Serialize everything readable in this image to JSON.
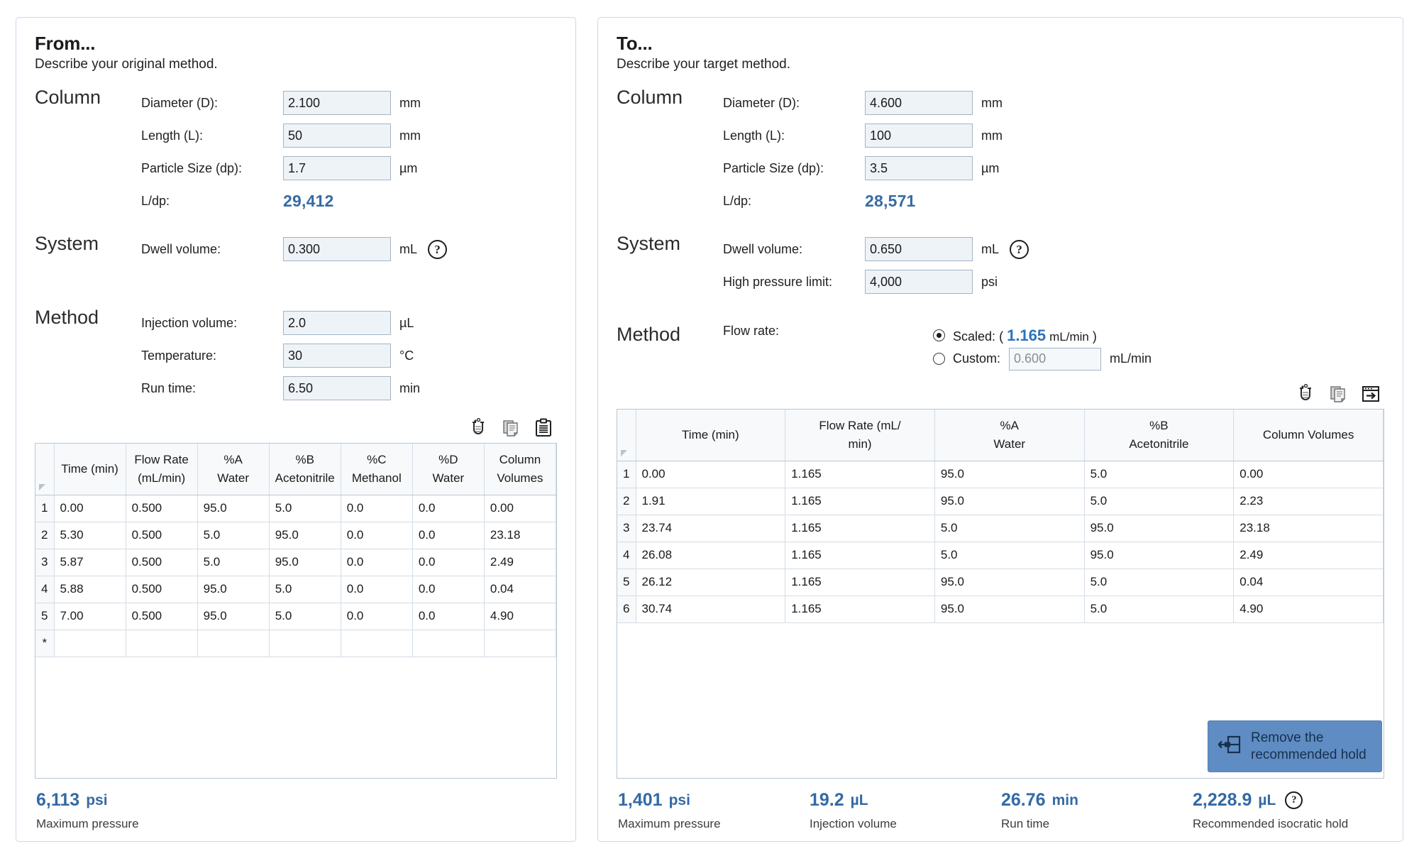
{
  "accent_blue": "#336aa3",
  "panels": [
    {
      "id": "from",
      "title": "From...",
      "subtitle": "Describe your original method.",
      "sections": {
        "column": {
          "label": "Column",
          "fields": [
            {
              "label": "Diameter (D):",
              "value": "2.100",
              "unit": "mm"
            },
            {
              "label": "Length (L):",
              "value": "50",
              "unit": "mm"
            },
            {
              "label": "Particle Size (dp):",
              "value": "1.7",
              "unit": "µm"
            }
          ],
          "calc_label": "L/dp:",
          "calc_value": "29,412"
        },
        "system": {
          "label": "System",
          "fields": [
            {
              "label": "Dwell volume:",
              "value": "0.300",
              "unit": "mL",
              "help": "?"
            }
          ]
        },
        "method": {
          "label": "Method",
          "fields": [
            {
              "label": "Injection volume:",
              "value": "2.0",
              "unit": "µL"
            },
            {
              "label": "Temperature:",
              "value": "30",
              "unit": "°C"
            },
            {
              "label": "Run time:",
              "value": "6.50",
              "unit": "min"
            }
          ]
        }
      },
      "toolbar": [
        {
          "name": "extract-gradient-icon",
          "title": "Extract"
        },
        {
          "name": "copy-icon",
          "title": "Copy"
        },
        {
          "name": "paste-clipboard-icon",
          "title": "Paste"
        }
      ],
      "table": {
        "columns": [
          {
            "line1": "Time (min)",
            "line2": ""
          },
          {
            "line1": "Flow Rate",
            "line2": "(mL/min)"
          },
          {
            "line1": "%A",
            "line2": "Water"
          },
          {
            "line1": "%B",
            "line2": "Acetonitrile"
          },
          {
            "line1": "%C",
            "line2": "Methanol"
          },
          {
            "line1": "%D",
            "line2": "Water"
          },
          {
            "line1": "Column",
            "line2": "Volumes"
          }
        ],
        "rows": [
          {
            "n": "1",
            "cells": [
              "0.00",
              "0.500",
              "95.0",
              "5.0",
              "0.0",
              "0.0",
              "0.00"
            ]
          },
          {
            "n": "2",
            "cells": [
              "5.30",
              "0.500",
              "5.0",
              "95.0",
              "0.0",
              "0.0",
              "23.18"
            ]
          },
          {
            "n": "3",
            "cells": [
              "5.87",
              "0.500",
              "5.0",
              "95.0",
              "0.0",
              "0.0",
              "2.49"
            ]
          },
          {
            "n": "4",
            "cells": [
              "5.88",
              "0.500",
              "95.0",
              "5.0",
              "0.0",
              "0.0",
              "0.04"
            ]
          },
          {
            "n": "5",
            "cells": [
              "7.00",
              "0.500",
              "95.0",
              "5.0",
              "0.0",
              "0.0",
              "4.90"
            ]
          },
          {
            "n": "*",
            "cells": [
              "",
              "",
              "",
              "",
              "",
              "",
              ""
            ]
          }
        ]
      },
      "summary": [
        {
          "value": "6,113",
          "unit": "psi",
          "label": "Maximum pressure",
          "help": ""
        }
      ]
    },
    {
      "id": "to",
      "title": "To...",
      "subtitle": "Describe your target method.",
      "sections": {
        "column": {
          "label": "Column",
          "fields": [
            {
              "label": "Diameter (D):",
              "value": "4.600",
              "unit": "mm"
            },
            {
              "label": "Length (L):",
              "value": "100",
              "unit": "mm"
            },
            {
              "label": "Particle Size (dp):",
              "value": "3.5",
              "unit": "µm"
            }
          ],
          "calc_label": "L/dp:",
          "calc_value": "28,571"
        },
        "system": {
          "label": "System",
          "fields": [
            {
              "label": "Dwell volume:",
              "value": "0.650",
              "unit": "mL",
              "help": "?"
            },
            {
              "label": "High pressure limit:",
              "value": "4,000",
              "unit": "psi"
            }
          ]
        },
        "method": {
          "label": "Method",
          "flow_label": "Flow rate:",
          "options": [
            {
              "id": "scaled",
              "selected": true,
              "label": "Scaled:",
              "open": "(",
              "value": "1.165",
              "unit": "mL/min",
              "close": ")"
            },
            {
              "id": "custom",
              "selected": false,
              "label": "Custom:",
              "placeholder": "0.600",
              "unit": "mL/min"
            }
          ]
        }
      },
      "toolbar": [
        {
          "name": "extract-gradient-icon",
          "title": "Extract"
        },
        {
          "name": "copy-icon",
          "title": "Copy"
        },
        {
          "name": "send-to-window-icon",
          "title": "Send to"
        }
      ],
      "table": {
        "columns": [
          {
            "line1": "Time (min)",
            "line2": ""
          },
          {
            "line1": "Flow Rate (mL/",
            "line2": "min)"
          },
          {
            "line1": "%A",
            "line2": "Water"
          },
          {
            "line1": "%B",
            "line2": "Acetonitrile"
          },
          {
            "line1": "Column Volumes",
            "line2": ""
          }
        ],
        "rows": [
          {
            "n": "1",
            "cells": [
              "0.00",
              "1.165",
              "95.0",
              "5.0",
              "0.00"
            ]
          },
          {
            "n": "2",
            "cells": [
              "1.91",
              "1.165",
              "95.0",
              "5.0",
              "2.23"
            ]
          },
          {
            "n": "3",
            "cells": [
              "23.74",
              "1.165",
              "5.0",
              "95.0",
              "23.18"
            ]
          },
          {
            "n": "4",
            "cells": [
              "26.08",
              "1.165",
              "5.0",
              "95.0",
              "2.49"
            ]
          },
          {
            "n": "5",
            "cells": [
              "26.12",
              "1.165",
              "95.0",
              "5.0",
              "0.04"
            ]
          },
          {
            "n": "6",
            "cells": [
              "30.74",
              "1.165",
              "95.0",
              "5.0",
              "4.90"
            ]
          }
        ]
      },
      "hold_button": {
        "line1": "Remove the",
        "line2": "recommended hold",
        "icon": "remove-hold-icon"
      },
      "summary": [
        {
          "value": "1,401",
          "unit": "psi",
          "label": "Maximum pressure",
          "help": ""
        },
        {
          "value": "19.2",
          "unit": "µL",
          "label": "Injection volume",
          "help": ""
        },
        {
          "value": "26.76",
          "unit": "min",
          "label": "Run time",
          "help": ""
        },
        {
          "value": "2,228.9",
          "unit": "µL",
          "label": "Recommended isocratic hold",
          "help": "?"
        }
      ]
    }
  ]
}
